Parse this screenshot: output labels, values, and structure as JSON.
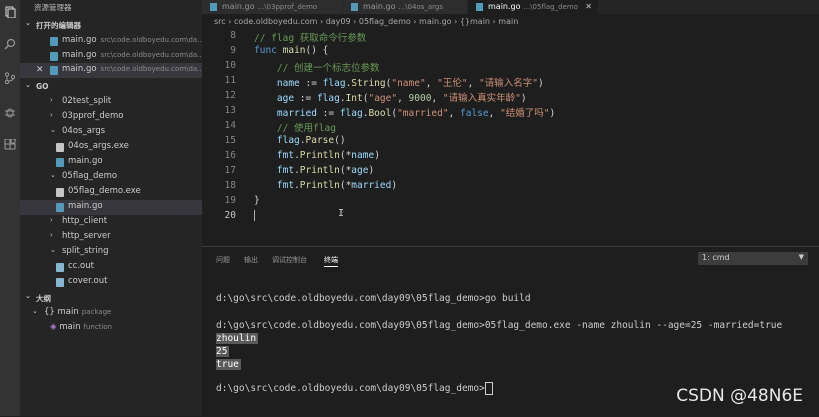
{
  "sidebar": {
    "title": "资源管理器",
    "open_editors_header": "打开的编辑器",
    "open_editors": [
      {
        "name": "main.go",
        "path": "src\\code.oldboyedu.com\\da..."
      },
      {
        "name": "main.go",
        "path": "src\\code.oldboyedu.com\\da..."
      },
      {
        "name": "main.go",
        "path": "src\\code.oldboyedu.com\\da..."
      }
    ],
    "workspace_header": "GO",
    "tree": [
      {
        "name": "02test_split"
      },
      {
        "name": "03pprof_demo"
      },
      {
        "name": "04os_args"
      },
      {
        "name": "04os_args.exe"
      },
      {
        "name": "main.go"
      },
      {
        "name": "05flag_demo"
      },
      {
        "name": "05flag_demo.exe"
      },
      {
        "name": "main.go"
      },
      {
        "name": "http_client"
      },
      {
        "name": "http_server"
      },
      {
        "name": "split_string"
      },
      {
        "name": "cc.out"
      },
      {
        "name": "cover.out"
      }
    ],
    "outline_header": "大纲",
    "outline": [
      {
        "name": "main",
        "kind": "package"
      },
      {
        "name": "main",
        "kind": "function"
      }
    ]
  },
  "tabs": [
    {
      "label": "main.go",
      "sub": "...\\03pprof_demo"
    },
    {
      "label": "main.go",
      "sub": "...\\04os_args"
    },
    {
      "label": "main.go",
      "sub": "...\\05flag_demo"
    }
  ],
  "breadcrumb": "src › code.oldboyedu.com › day09 › 05flag_demo › main.go › {}main › main",
  "editor": {
    "line_numbers": [
      "8",
      "9",
      "10",
      "11",
      "12",
      "13",
      "14",
      "15",
      "16",
      "17",
      "18",
      "19",
      "20"
    ],
    "lines": [
      "// flag 获取命令行参数",
      "func main() {",
      "    // 创建一个标志位参数",
      "    name := flag.String(\"name\", \"王伦\", \"请输入名字\")",
      "    age := flag.Int(\"age\", 9000, \"请输入真实年龄\")",
      "    married := flag.Bool(\"married\", false, \"结婚了吗\")",
      "    // 使用flag",
      "    flag.Parse()",
      "    fmt.Println(*name)",
      "    fmt.Println(*age)",
      "    fmt.Println(*married)",
      "}",
      ""
    ]
  },
  "panel": {
    "tabs": [
      "问题",
      "输出",
      "调试控制台",
      "终端"
    ],
    "terminal_select": "1: cmd",
    "lines": [
      "d:\\go\\src\\code.oldboyedu.com\\day09\\05flag_demo>go build",
      "",
      "d:\\go\\src\\code.oldboyedu.com\\day09\\05flag_demo>05flag_demo.exe -name zhoulin --age=25 -married=true",
      "zhoulin",
      "25",
      "true",
      "",
      "d:\\go\\src\\code.oldboyedu.com\\day09\\05flag_demo>"
    ]
  },
  "watermark": "CSDN @48N6E"
}
